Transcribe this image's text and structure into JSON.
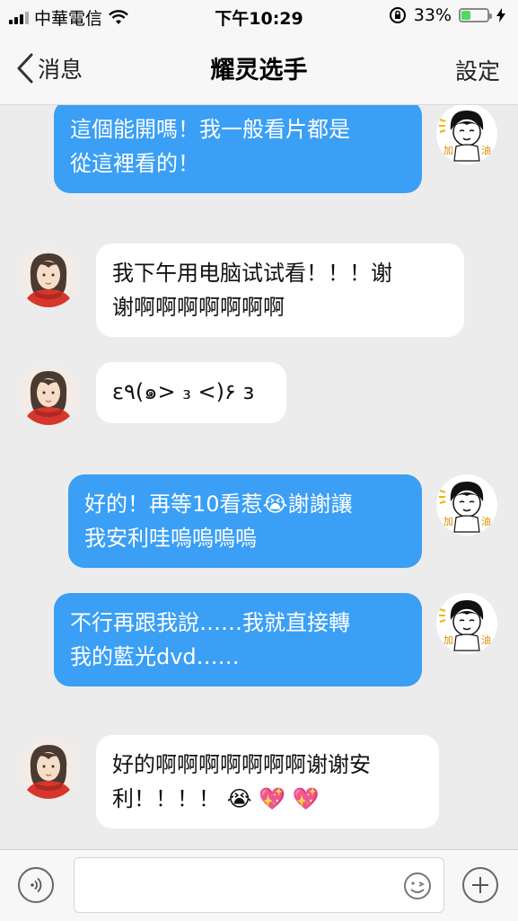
{
  "status_bar": {
    "carrier": "中華電信",
    "time": "下午10:29",
    "battery_percent": "33%",
    "battery_level": 0.33,
    "icons": [
      "signal-icon",
      "wifi-icon",
      "orientation-lock-icon",
      "battery-icon",
      "charging-icon"
    ]
  },
  "nav": {
    "back_label": "消息",
    "title": "耀灵选手",
    "settings_label": "設定"
  },
  "messages": [
    {
      "direction": "out",
      "text": "這個能開嗎！我一般看片都是\n從這裡看的！"
    },
    {
      "direction": "in",
      "text": "我下午用电脑试试看！！！谢\n谢啊啊啊啊啊啊啊"
    },
    {
      "direction": "in",
      "text": "ε٩(๑> ₃ <)۶ з"
    },
    {
      "direction": "out",
      "text": "好的！再等10看惹😭謝謝讓\n我安利哇嗚嗚嗚嗚"
    },
    {
      "direction": "out",
      "text": "不行再跟我說……我就直接轉\n我的藍光dvd……"
    },
    {
      "direction": "in",
      "text": "好的啊啊啊啊啊啊啊谢谢安\n利！！！！ 😭 💖 💖"
    }
  ],
  "avatars": {
    "self_avatar_text_left": "加",
    "self_avatar_text_right": "油",
    "colors": {
      "self_bubble": "#3a9ff5",
      "other_bubble": "#ffffff",
      "scarf": "#d6362b"
    }
  },
  "input_bar": {
    "placeholder": "",
    "icons": [
      "voice-icon",
      "emoji-icon",
      "plus-icon"
    ]
  }
}
